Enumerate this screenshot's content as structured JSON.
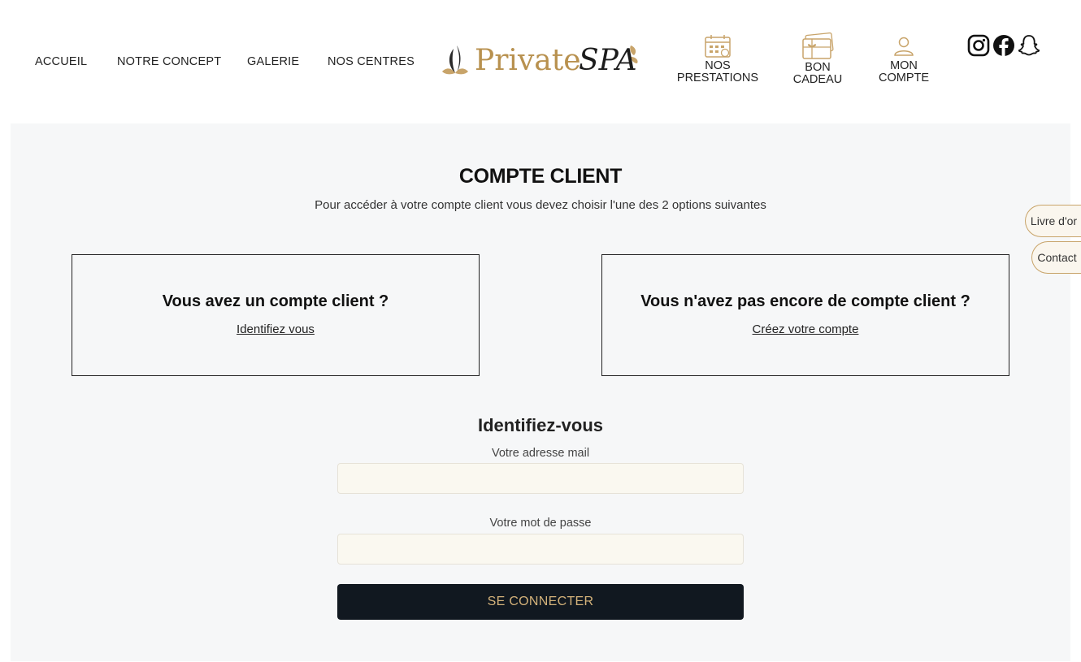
{
  "nav": {
    "accueil": "ACCUEIL",
    "concept": "NOTRE CONCEPT",
    "galerie": "GALERIE",
    "centres": "NOS CENTRES"
  },
  "logo": {
    "word1": "Private",
    "word2": "SPA"
  },
  "icon_nav": [
    {
      "line1": "NOS",
      "line2": "PRESTATIONS",
      "icon": "calendar-icon"
    },
    {
      "line1": "BON",
      "line2": "CADEAU",
      "icon": "gift-card-icon"
    },
    {
      "line1": "MON",
      "line2": "COMPTE",
      "icon": "user-icon"
    }
  ],
  "social": [
    "instagram-icon",
    "facebook-icon",
    "snapchat-icon"
  ],
  "main": {
    "title": "COMPTE CLIENT",
    "subtitle": "Pour accéder à votre compte client vous devez choisir l'une des 2 options suivantes"
  },
  "boxes": {
    "existing": {
      "heading": "Vous avez un compte client ?",
      "link": "Identifiez vous"
    },
    "new": {
      "heading": "Vous n'avez pas encore de compte client ?",
      "link": "Créez votre compte"
    }
  },
  "form": {
    "title": "Identifiez-vous",
    "email_label": "Votre adresse mail",
    "email_value": "",
    "password_label": "Votre mot de passe",
    "password_value": "",
    "submit": "SE CONNECTER"
  },
  "side_tabs": {
    "guestbook": "Livre d'or",
    "contact": "Contact"
  },
  "colors": {
    "gold": "#c8a46a",
    "dark": "#111820",
    "bg": "#f6f7f8",
    "input_bg": "#faf8f0"
  }
}
